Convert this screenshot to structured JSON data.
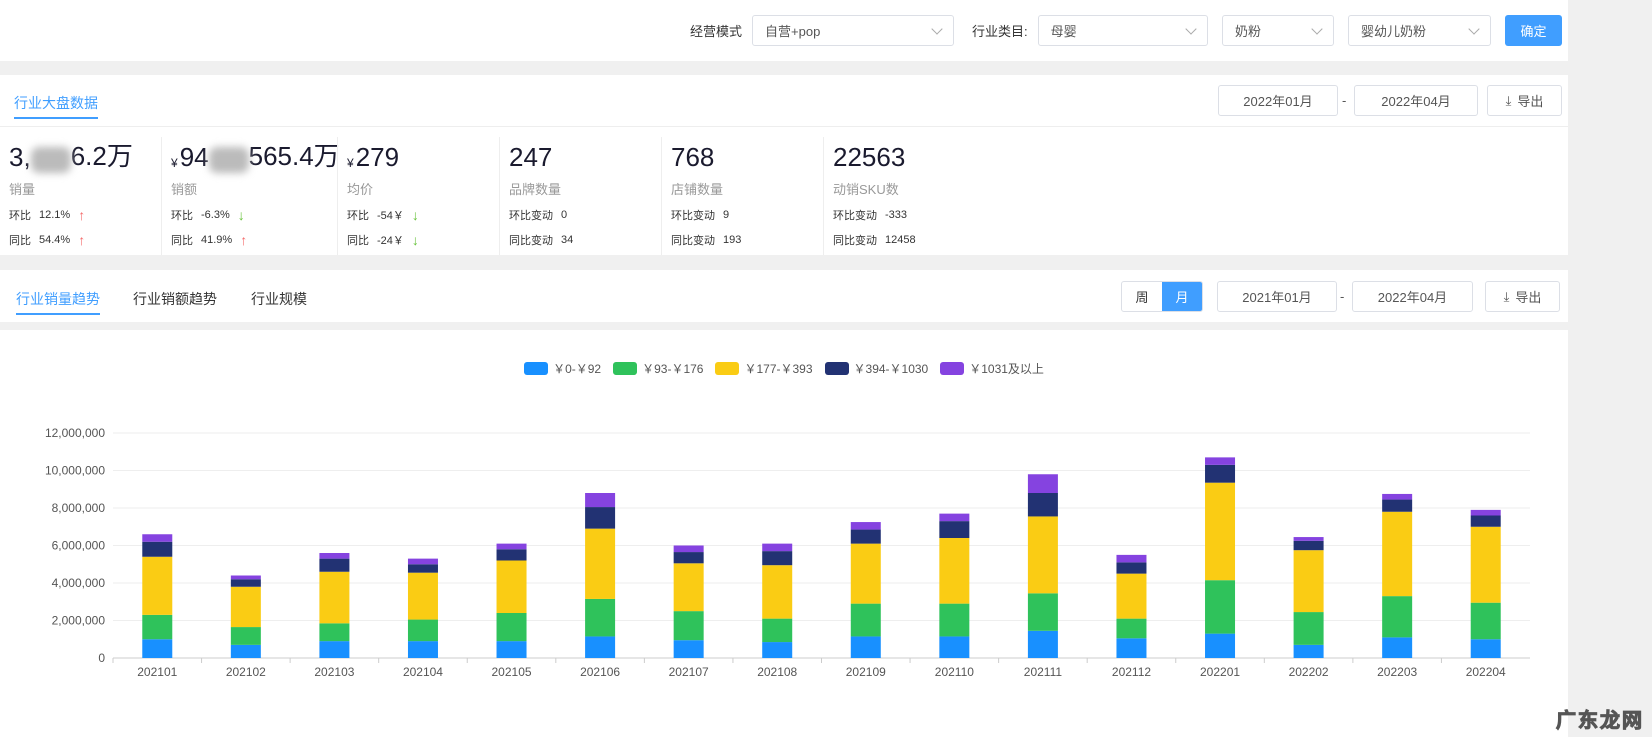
{
  "filters": {
    "mode_label": "经营模式",
    "mode_value": "自营+pop",
    "category_label": "行业类目:",
    "cat1": "母婴",
    "cat2": "奶粉",
    "cat3": "婴幼儿奶粉",
    "confirm": "确定"
  },
  "overview": {
    "tab": "行业大盘数据",
    "date_from": "2022年01月",
    "date_to": "2022年04月",
    "dash": "-",
    "export": "导出",
    "stats": [
      {
        "prefix": "",
        "value_a": "3,",
        "value_b": "6.2万",
        "name": "销量",
        "r1_label": "环比",
        "r1_value": "12.1%",
        "r1_dir": "up",
        "r2_label": "同比",
        "r2_value": "54.4%",
        "r2_dir": "up"
      },
      {
        "prefix": "¥",
        "value_a": "94",
        "value_b": "565.4万",
        "name": "销额",
        "r1_label": "环比",
        "r1_value": "-6.3%",
        "r1_dir": "down",
        "r2_label": "同比",
        "r2_value": "41.9%",
        "r2_dir": "up"
      },
      {
        "prefix": "¥",
        "value_a": "279",
        "value_b": "",
        "name": "均价",
        "r1_label": "环比",
        "r1_value": "-54￥",
        "r1_dir": "down",
        "r2_label": "同比",
        "r2_value": "-24￥",
        "r2_dir": "down"
      },
      {
        "prefix": "",
        "value_a": "247",
        "value_b": "",
        "name": "品牌数量",
        "r1_label": "环比变动",
        "r1_value": "0",
        "r2_label": "同比变动",
        "r2_value": "34"
      },
      {
        "prefix": "",
        "value_a": "768",
        "value_b": "",
        "name": "店铺数量",
        "r1_label": "环比变动",
        "r1_value": "9",
        "r2_label": "同比变动",
        "r2_value": "193"
      },
      {
        "prefix": "",
        "value_a": "22563",
        "value_b": "",
        "name": "动销SKU数",
        "r1_label": "环比变动",
        "r1_value": "-333",
        "r2_label": "同比变动",
        "r2_value": "12458"
      }
    ]
  },
  "trend": {
    "tabs": [
      "行业销量趋势",
      "行业销额趋势",
      "行业规模"
    ],
    "week": "周",
    "month": "月",
    "date_from": "2021年01月",
    "date_to": "2022年04月",
    "dash": "-",
    "export": "导出"
  },
  "chart_data": {
    "type": "bar",
    "stacked": true,
    "ylim": [
      0,
      12000000
    ],
    "yticks": [
      "0",
      "2,000,000",
      "4,000,000",
      "6,000,000",
      "8,000,000",
      "10,000,000",
      "12,000,000"
    ],
    "legend_position": "top-center",
    "grid": true,
    "categories": [
      "202101",
      "202102",
      "202103",
      "202104",
      "202105",
      "202106",
      "202107",
      "202108",
      "202109",
      "202110",
      "202111",
      "202112",
      "202201",
      "202202",
      "202203",
      "202204"
    ],
    "series": [
      {
        "name": "￥0-￥92",
        "color": "#1890ff",
        "values": [
          1000000,
          700000,
          900000,
          900000,
          900000,
          1150000,
          950000,
          850000,
          1150000,
          1150000,
          1450000,
          1050000,
          1300000,
          700000,
          1100000,
          1000000
        ]
      },
      {
        "name": "￥93-￥176",
        "color": "#2fc25b",
        "values": [
          1300000,
          950000,
          950000,
          1150000,
          1500000,
          2000000,
          1550000,
          1250000,
          1750000,
          1750000,
          2000000,
          1050000,
          2850000,
          1750000,
          2200000,
          1950000
        ]
      },
      {
        "name": "￥177-￥393",
        "color": "#facc14",
        "values": [
          3100000,
          2150000,
          2750000,
          2500000,
          2800000,
          3750000,
          2550000,
          2850000,
          3200000,
          3500000,
          4100000,
          2400000,
          5200000,
          3300000,
          4500000,
          4050000
        ]
      },
      {
        "name": "￥394-￥1030",
        "color": "#223273",
        "values": [
          800000,
          400000,
          700000,
          450000,
          600000,
          1150000,
          600000,
          750000,
          750000,
          900000,
          1250000,
          600000,
          950000,
          500000,
          650000,
          600000
        ]
      },
      {
        "name": "￥1031及以上",
        "color": "#8543e0",
        "values": [
          400000,
          200000,
          300000,
          300000,
          300000,
          750000,
          350000,
          400000,
          400000,
          400000,
          1000000,
          400000,
          400000,
          200000,
          300000,
          300000
        ]
      }
    ]
  },
  "watermark": "广东龙网"
}
